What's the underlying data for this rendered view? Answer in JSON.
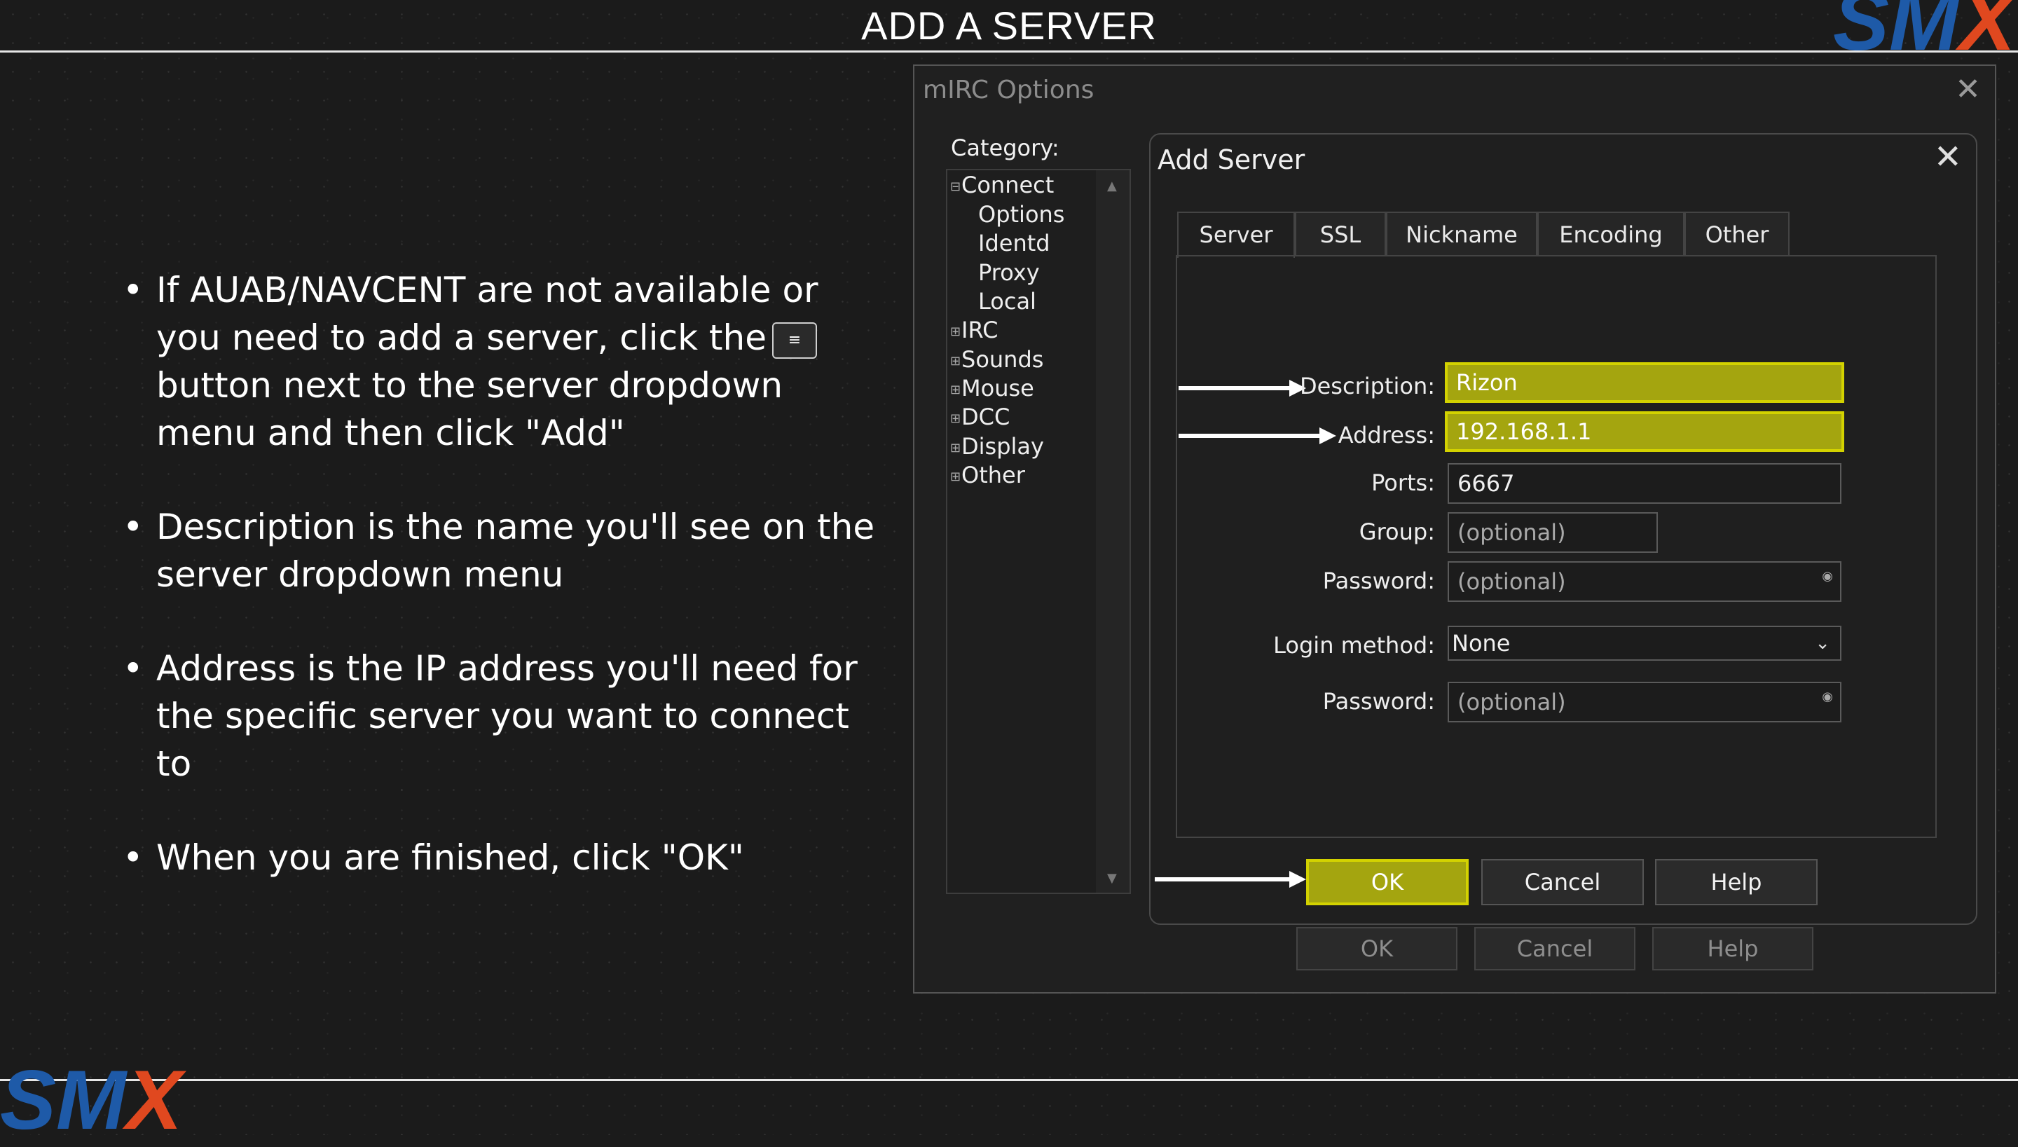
{
  "slide": {
    "title": "ADD A SERVER",
    "logo_text_1": "SM",
    "logo_text_2": "X"
  },
  "bullets": {
    "b1_part1": "If AUAB/NAVCENT are not available or you need to add a server, click the",
    "b1_button_glyph": "≡",
    "b1_part2": "button next to the server dropdown menu and then click \"Add\"",
    "b2": "Description is the name you'll see on the server dropdown menu",
    "b3": "Address is the IP address you'll need for the specific server you want to connect to",
    "b4": "When you are finished, click \"OK\""
  },
  "options_window": {
    "title": "mIRC Options",
    "category_label": "Category:",
    "tree": {
      "connect": "Connect",
      "options": "Options",
      "identd": "Identd",
      "proxy": "Proxy",
      "local": "Local",
      "irc": "IRC",
      "sounds": "Sounds",
      "mouse": "Mouse",
      "dcc": "DCC",
      "display": "Display",
      "other": "Other",
      "expanded_glyph": "⊟",
      "collapsed_glyph": "⊞"
    },
    "buttons": {
      "ok": "OK",
      "cancel": "Cancel",
      "help": "Help"
    }
  },
  "add_server": {
    "title": "Add Server",
    "tabs": {
      "server": "Server",
      "ssl": "SSL",
      "nickname": "Nickname",
      "encoding": "Encoding",
      "other": "Other"
    },
    "labels": {
      "description": "Description:",
      "address": "Address:",
      "ports": "Ports:",
      "group": "Group:",
      "password": "Password:",
      "login_method": "Login method:",
      "password2": "Password:"
    },
    "values": {
      "description": "Rizon",
      "address": "192.168.1.1",
      "ports": "6667",
      "group_placeholder": "(optional)",
      "password_placeholder": "(optional)",
      "login_method": "None",
      "password2_placeholder": "(optional)"
    },
    "buttons": {
      "ok": "OK",
      "cancel": "Cancel",
      "help": "Help"
    }
  },
  "colors": {
    "highlight": "#a4a50f",
    "highlight_border": "#d3d200",
    "logo_blue": "#1e5aa8",
    "logo_orange": "#e0481f"
  }
}
